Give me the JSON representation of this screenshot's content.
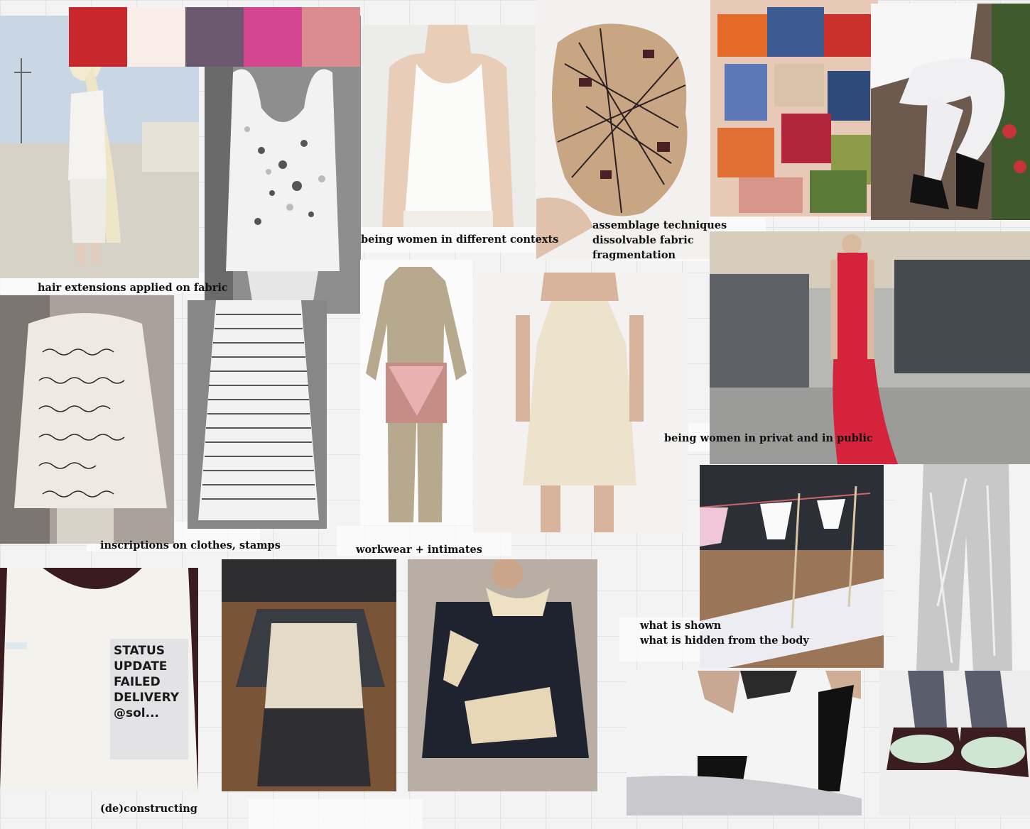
{
  "palette": [
    "#c8282b",
    "#faefe8",
    "#6c5970",
    "#d4468f",
    "#db8c8f"
  ],
  "labels": {
    "hair": "hair extensions applied on fabric",
    "contexts": "being women in different contexts",
    "assemblage": "assemblage techniques\ndissolvable fabric\nfragmentation",
    "public": "being women in privat and in public",
    "inscriptions": "inscriptions on clothes, stamps",
    "workwear": "workwear + intimates",
    "shown": "what is shown\nwhat is hidden from the body",
    "deconstructing": "(de)constructing"
  },
  "stamp_text": "STATUS\nUPDATE\nFAILED\nDELIVERY\n@sol..."
}
